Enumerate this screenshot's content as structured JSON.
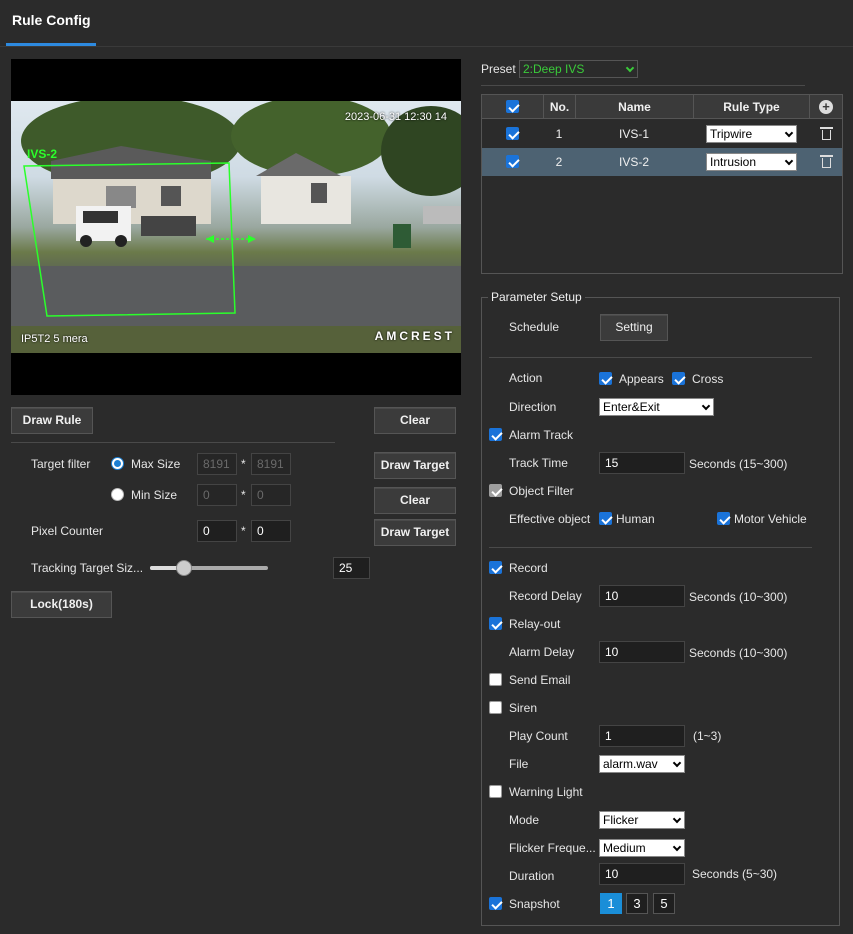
{
  "tab": {
    "title": "Rule Config"
  },
  "video": {
    "timestamp": "2023-06-31 12:30 14",
    "camera_name": "IP5T2 5 mera",
    "logo": "AMCREST",
    "rule_tag": "IVS-2"
  },
  "left": {
    "draw_rule": "Draw Rule",
    "clear1": "Clear",
    "target_filter_label": "Target filter",
    "max_size_label": "Max Size",
    "max_w": "8191",
    "max_h": "8191",
    "draw_target1": "Draw Target",
    "min_size_label": "Min Size",
    "min_w": "0",
    "min_h": "0",
    "clear2": "Clear",
    "pixel_counter_label": "Pixel Counter",
    "pixel_w": "0",
    "pixel_h": "0",
    "draw_target2": "Draw Target",
    "tracking_label": "Tracking Target Siz...",
    "tracking_value": "25",
    "tracking_level": 0.25,
    "lock": "Lock(180s)",
    "star": "*"
  },
  "preset": {
    "label": "Preset",
    "value": "2:Deep IVS"
  },
  "rules": {
    "headers": {
      "no": "No.",
      "name": "Name",
      "type": "Rule Type"
    },
    "rows": [
      {
        "no": "1",
        "name": "IVS-1",
        "type": "Tripwire"
      },
      {
        "no": "2",
        "name": "IVS-2",
        "type": "Intrusion"
      }
    ]
  },
  "params": {
    "legend": "Parameter Setup",
    "schedule_label": "Schedule",
    "setting": "Setting",
    "action_label": "Action",
    "appears": "Appears",
    "cross": "Cross",
    "direction_label": "Direction",
    "direction_value": "Enter&Exit",
    "alarm_track": "Alarm Track",
    "track_time_label": "Track Time",
    "track_time_value": "15",
    "track_time_hint": "Seconds (15~300)",
    "object_filter": "Object Filter",
    "effective_label": "Effective object",
    "human": "Human",
    "motor_vehicle": "Motor Vehicle",
    "record": "Record",
    "record_delay_label": "Record Delay",
    "record_delay_value": "10",
    "record_delay_hint": "Seconds (10~300)",
    "relay_out": "Relay-out",
    "alarm_delay_label": "Alarm Delay",
    "alarm_delay_value": "10",
    "alarm_delay_hint": "Seconds (10~300)",
    "send_email": "Send Email",
    "siren": "Siren",
    "play_count_label": "Play Count",
    "play_count_value": "1",
    "play_count_hint": "(1~3)",
    "file_label": "File",
    "file_value": "alarm.wav",
    "warning_light": "Warning Light",
    "mode_label": "Mode",
    "mode_value": "Flicker",
    "flicker_label": "Flicker Freque...",
    "flicker_value": "Medium",
    "duration_label": "Duration",
    "duration_value": "10",
    "duration_hint": "Seconds (5~30)",
    "snapshot": "Snapshot",
    "snap_options": [
      "1",
      "3",
      "5"
    ]
  },
  "colors": {
    "accent": "#2d8ae0",
    "selected_row": "#4d6272",
    "preset_text": "#3acb3a",
    "rule_line": "#2bff2b"
  }
}
